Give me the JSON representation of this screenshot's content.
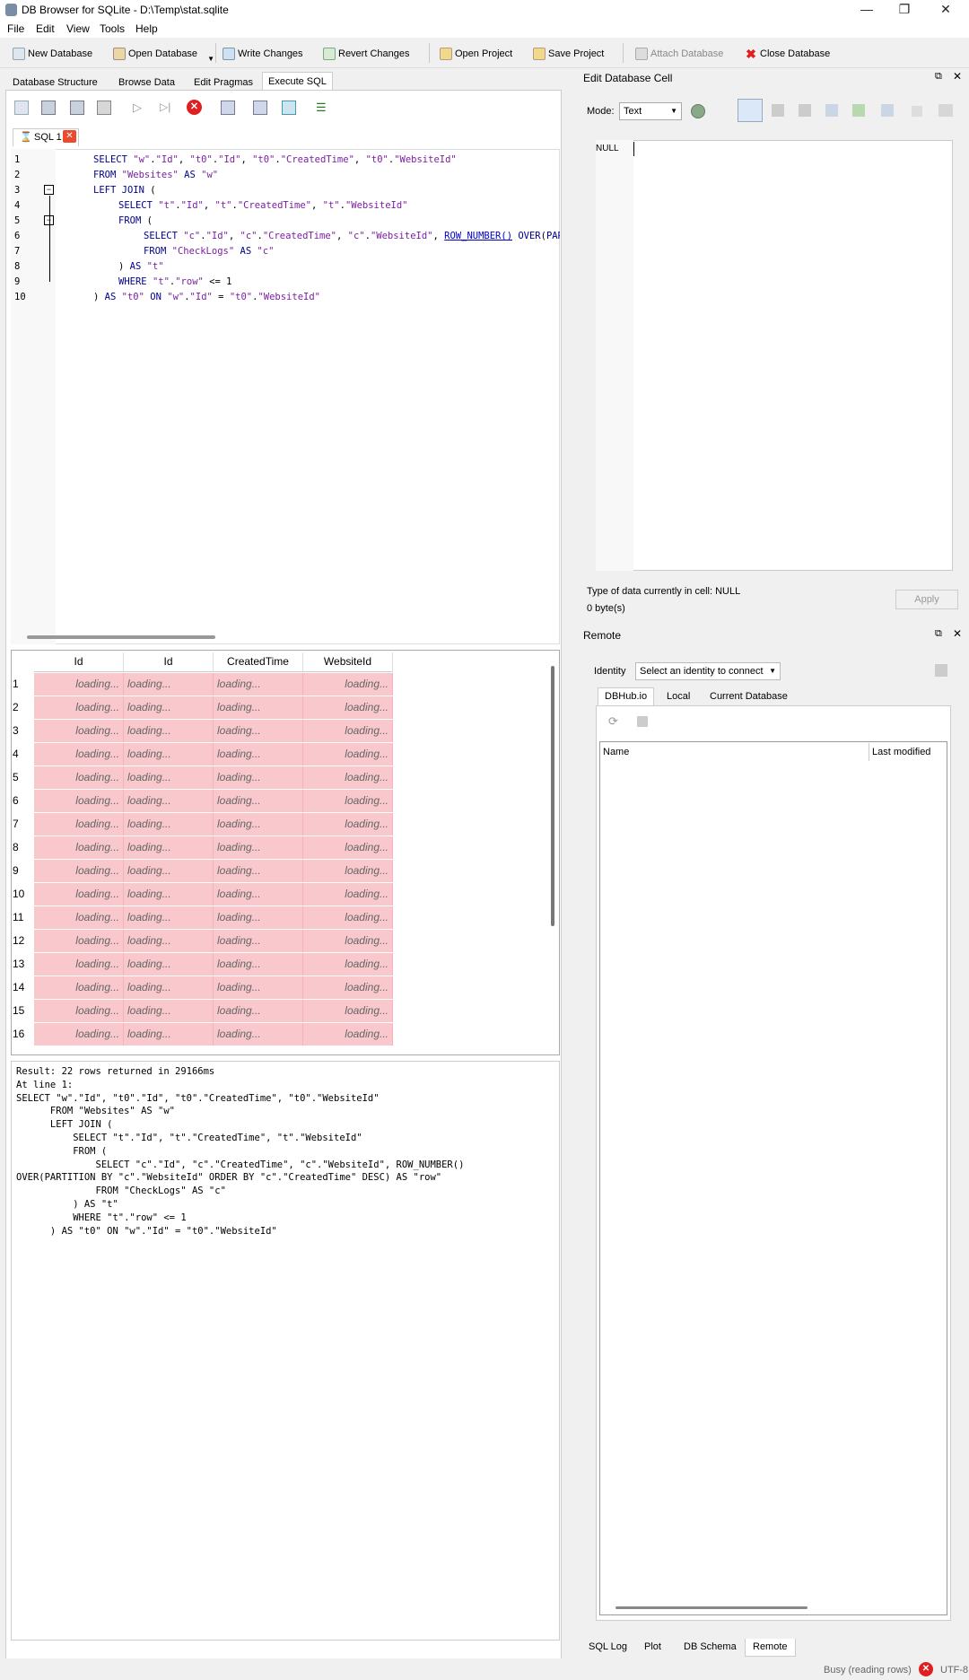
{
  "window": {
    "title": "DB Browser for SQLite - D:\\Temp\\stat.sqlite",
    "minimize": "—",
    "restore": "❐",
    "close": "✕"
  },
  "menu": [
    "File",
    "Edit",
    "View",
    "Tools",
    "Help"
  ],
  "toolbar": {
    "new_db": "New Database",
    "open_db": "Open Database",
    "write": "Write Changes",
    "revert": "Revert Changes",
    "open_project": "Open Project",
    "save_project": "Save Project",
    "attach": "Attach Database",
    "close_db": "Close Database"
  },
  "tabs": [
    "Database Structure",
    "Browse Data",
    "Edit Pragmas",
    "Execute SQL"
  ],
  "sql_tab": "SQL 1",
  "editor": {
    "line_numbers": [
      "1",
      "2",
      "3",
      "4",
      "5",
      "6",
      "7",
      "8",
      "9",
      "10"
    ]
  },
  "grid": {
    "headers": [
      "Id",
      "Id",
      "CreatedTime",
      "WebsiteId"
    ],
    "rows": [
      "1",
      "2",
      "3",
      "4",
      "5",
      "6",
      "7",
      "8",
      "9",
      "10",
      "11",
      "12",
      "13",
      "14",
      "15",
      "16"
    ],
    "loading": "loading..."
  },
  "message": "Result: 22 rows returned in 29166ms\nAt line 1:\nSELECT \"w\".\"Id\", \"t0\".\"Id\", \"t0\".\"CreatedTime\", \"t0\".\"WebsiteId\"\n      FROM \"Websites\" AS \"w\"\n      LEFT JOIN (\n          SELECT \"t\".\"Id\", \"t\".\"CreatedTime\", \"t\".\"WebsiteId\"\n          FROM (\n              SELECT \"c\".\"Id\", \"c\".\"CreatedTime\", \"c\".\"WebsiteId\", ROW_NUMBER()\nOVER(PARTITION BY \"c\".\"WebsiteId\" ORDER BY \"c\".\"CreatedTime\" DESC) AS \"row\"\n              FROM \"CheckLogs\" AS \"c\"\n          ) AS \"t\"\n          WHERE \"t\".\"row\" <= 1\n      ) AS \"t0\" ON \"w\".\"Id\" = \"t0\".\"WebsiteId\"",
  "edit_cell": {
    "title": "Edit Database Cell",
    "mode_label": "Mode:",
    "mode_value": "Text",
    "null_text": "NULL",
    "type_text": "Type of data currently in cell: NULL",
    "size_text": "0 byte(s)",
    "apply": "Apply"
  },
  "remote": {
    "title": "Remote",
    "identity_label": "Identity",
    "identity_value": "Select an identity to connect",
    "tabs": [
      "DBHub.io",
      "Local",
      "Current Database"
    ],
    "col_name": "Name",
    "col_modified": "Last modified"
  },
  "bottom_tabs": [
    "SQL Log",
    "Plot",
    "DB Schema",
    "Remote"
  ],
  "status": {
    "text": "Busy (reading rows)",
    "encoding": "UTF-8"
  },
  "colors": {
    "loading_cell": "#f9c8cc",
    "keyword": "#00008b",
    "string": "#7b1fa2",
    "stop_red": "#e02020"
  }
}
